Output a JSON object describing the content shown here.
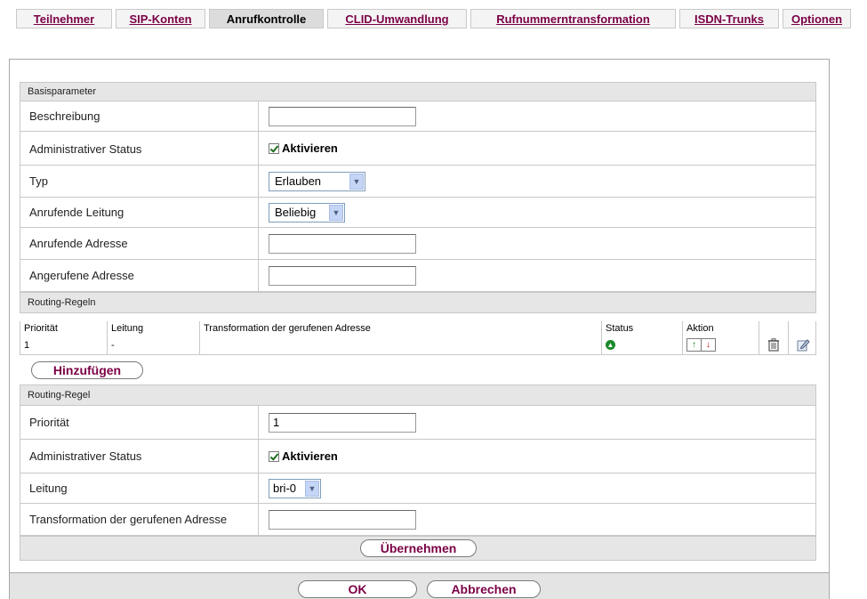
{
  "tabs": [
    {
      "label": "Teilnehmer",
      "active": false
    },
    {
      "label": "SIP-Konten",
      "active": false
    },
    {
      "label": "Anrufkontrolle",
      "active": true
    },
    {
      "label": "CLID-Umwandlung",
      "active": false
    },
    {
      "label": "Rufnummerntransformation",
      "active": false
    },
    {
      "label": "ISDN-Trunks",
      "active": false
    },
    {
      "label": "Optionen",
      "active": false
    }
  ],
  "basis": {
    "header": "Basisparameter",
    "beschreibung_label": "Beschreibung",
    "beschreibung_value": "",
    "admin_status_label": "Administrativer Status",
    "admin_status_check": "Aktivieren",
    "typ_label": "Typ",
    "typ_value": "Erlauben",
    "leitung_label": "Anrufende Leitung",
    "leitung_value": "Beliebig",
    "anrufende_adresse_label": "Anrufende Adresse",
    "anrufende_adresse_value": "",
    "angerufene_adresse_label": "Angerufene Adresse",
    "angerufene_adresse_value": ""
  },
  "routing_rules": {
    "header": "Routing-Regeln",
    "columns": {
      "prioritaet": "Priorität",
      "leitung": "Leitung",
      "transformation": "Transformation der gerufenen Adresse",
      "status": "Status",
      "aktion": "Aktion"
    },
    "rows": [
      {
        "prioritaet": "1",
        "leitung": "-",
        "transformation": ""
      }
    ],
    "add_button": "Hinzufügen"
  },
  "routing_rule": {
    "header": "Routing-Regel",
    "prioritaet_label": "Priorität",
    "prioritaet_value": "1",
    "admin_status_label": "Administrativer Status",
    "admin_status_check": "Aktivieren",
    "leitung_label": "Leitung",
    "leitung_value": "bri-0",
    "transformation_label": "Transformation der gerufenen Adresse",
    "transformation_value": "",
    "apply_button": "Übernehmen"
  },
  "footer": {
    "ok_button": "OK",
    "cancel_button": "Abbrechen"
  },
  "colors": {
    "link": "#7b0046",
    "section_bg": "#e6e6e6",
    "status_ok": "#1a8a2a",
    "arrow_down": "#d00000"
  }
}
